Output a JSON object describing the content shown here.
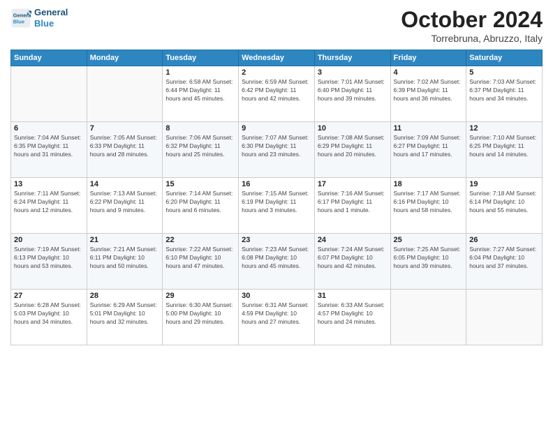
{
  "logo": {
    "line1": "General",
    "line2": "Blue"
  },
  "title": "October 2024",
  "location": "Torrebruna, Abruzzo, Italy",
  "days_of_week": [
    "Sunday",
    "Monday",
    "Tuesday",
    "Wednesday",
    "Thursday",
    "Friday",
    "Saturday"
  ],
  "weeks": [
    [
      {
        "day": "",
        "info": ""
      },
      {
        "day": "",
        "info": ""
      },
      {
        "day": "1",
        "info": "Sunrise: 6:58 AM\nSunset: 6:44 PM\nDaylight: 11 hours and 45 minutes."
      },
      {
        "day": "2",
        "info": "Sunrise: 6:59 AM\nSunset: 6:42 PM\nDaylight: 11 hours and 42 minutes."
      },
      {
        "day": "3",
        "info": "Sunrise: 7:01 AM\nSunset: 6:40 PM\nDaylight: 11 hours and 39 minutes."
      },
      {
        "day": "4",
        "info": "Sunrise: 7:02 AM\nSunset: 6:39 PM\nDaylight: 11 hours and 36 minutes."
      },
      {
        "day": "5",
        "info": "Sunrise: 7:03 AM\nSunset: 6:37 PM\nDaylight: 11 hours and 34 minutes."
      }
    ],
    [
      {
        "day": "6",
        "info": "Sunrise: 7:04 AM\nSunset: 6:35 PM\nDaylight: 11 hours and 31 minutes."
      },
      {
        "day": "7",
        "info": "Sunrise: 7:05 AM\nSunset: 6:33 PM\nDaylight: 11 hours and 28 minutes."
      },
      {
        "day": "8",
        "info": "Sunrise: 7:06 AM\nSunset: 6:32 PM\nDaylight: 11 hours and 25 minutes."
      },
      {
        "day": "9",
        "info": "Sunrise: 7:07 AM\nSunset: 6:30 PM\nDaylight: 11 hours and 23 minutes."
      },
      {
        "day": "10",
        "info": "Sunrise: 7:08 AM\nSunset: 6:29 PM\nDaylight: 11 hours and 20 minutes."
      },
      {
        "day": "11",
        "info": "Sunrise: 7:09 AM\nSunset: 6:27 PM\nDaylight: 11 hours and 17 minutes."
      },
      {
        "day": "12",
        "info": "Sunrise: 7:10 AM\nSunset: 6:25 PM\nDaylight: 11 hours and 14 minutes."
      }
    ],
    [
      {
        "day": "13",
        "info": "Sunrise: 7:11 AM\nSunset: 6:24 PM\nDaylight: 11 hours and 12 minutes."
      },
      {
        "day": "14",
        "info": "Sunrise: 7:13 AM\nSunset: 6:22 PM\nDaylight: 11 hours and 9 minutes."
      },
      {
        "day": "15",
        "info": "Sunrise: 7:14 AM\nSunset: 6:20 PM\nDaylight: 11 hours and 6 minutes."
      },
      {
        "day": "16",
        "info": "Sunrise: 7:15 AM\nSunset: 6:19 PM\nDaylight: 11 hours and 3 minutes."
      },
      {
        "day": "17",
        "info": "Sunrise: 7:16 AM\nSunset: 6:17 PM\nDaylight: 11 hours and 1 minute."
      },
      {
        "day": "18",
        "info": "Sunrise: 7:17 AM\nSunset: 6:16 PM\nDaylight: 10 hours and 58 minutes."
      },
      {
        "day": "19",
        "info": "Sunrise: 7:18 AM\nSunset: 6:14 PM\nDaylight: 10 hours and 55 minutes."
      }
    ],
    [
      {
        "day": "20",
        "info": "Sunrise: 7:19 AM\nSunset: 6:13 PM\nDaylight: 10 hours and 53 minutes."
      },
      {
        "day": "21",
        "info": "Sunrise: 7:21 AM\nSunset: 6:11 PM\nDaylight: 10 hours and 50 minutes."
      },
      {
        "day": "22",
        "info": "Sunrise: 7:22 AM\nSunset: 6:10 PM\nDaylight: 10 hours and 47 minutes."
      },
      {
        "day": "23",
        "info": "Sunrise: 7:23 AM\nSunset: 6:08 PM\nDaylight: 10 hours and 45 minutes."
      },
      {
        "day": "24",
        "info": "Sunrise: 7:24 AM\nSunset: 6:07 PM\nDaylight: 10 hours and 42 minutes."
      },
      {
        "day": "25",
        "info": "Sunrise: 7:25 AM\nSunset: 6:05 PM\nDaylight: 10 hours and 39 minutes."
      },
      {
        "day": "26",
        "info": "Sunrise: 7:27 AM\nSunset: 6:04 PM\nDaylight: 10 hours and 37 minutes."
      }
    ],
    [
      {
        "day": "27",
        "info": "Sunrise: 6:28 AM\nSunset: 5:03 PM\nDaylight: 10 hours and 34 minutes."
      },
      {
        "day": "28",
        "info": "Sunrise: 6:29 AM\nSunset: 5:01 PM\nDaylight: 10 hours and 32 minutes."
      },
      {
        "day": "29",
        "info": "Sunrise: 6:30 AM\nSunset: 5:00 PM\nDaylight: 10 hours and 29 minutes."
      },
      {
        "day": "30",
        "info": "Sunrise: 6:31 AM\nSunset: 4:59 PM\nDaylight: 10 hours and 27 minutes."
      },
      {
        "day": "31",
        "info": "Sunrise: 6:33 AM\nSunset: 4:57 PM\nDaylight: 10 hours and 24 minutes."
      },
      {
        "day": "",
        "info": ""
      },
      {
        "day": "",
        "info": ""
      }
    ]
  ]
}
